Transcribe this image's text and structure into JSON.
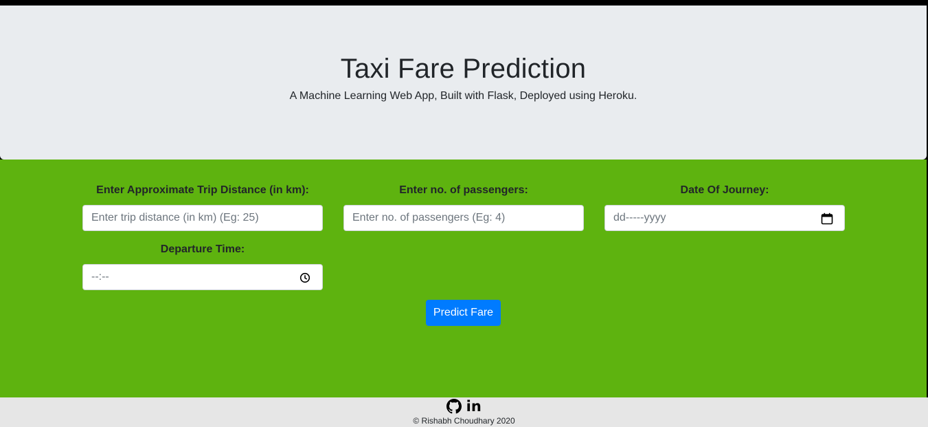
{
  "header": {
    "title": "Taxi Fare Prediction",
    "subtitle": "A Machine Learning Web App, Built with Flask, Deployed using Heroku."
  },
  "form": {
    "distance": {
      "label": "Enter Approximate Trip Distance (in km):",
      "placeholder": "Enter trip distance (in km) (Eg: 25)"
    },
    "passengers": {
      "label": "Enter no. of passengers:",
      "placeholder": "Enter no. of passengers (Eg: 4)"
    },
    "date": {
      "label": "Date Of Journey:",
      "value": "dd-----yyyy"
    },
    "time": {
      "label": "Departure Time:",
      "value": "--:--"
    },
    "submit_label": "Predict Fare"
  },
  "footer": {
    "icons": [
      "github-icon",
      "linkedin-icon"
    ],
    "linkedin_text": "in",
    "copyright": "© Rishabh Choudhary 2020"
  },
  "colors": {
    "header_bg": "#e9ecef",
    "form_bg": "#5eb30f",
    "button": "#007bff",
    "footer_bg": "#e6e6e6"
  }
}
